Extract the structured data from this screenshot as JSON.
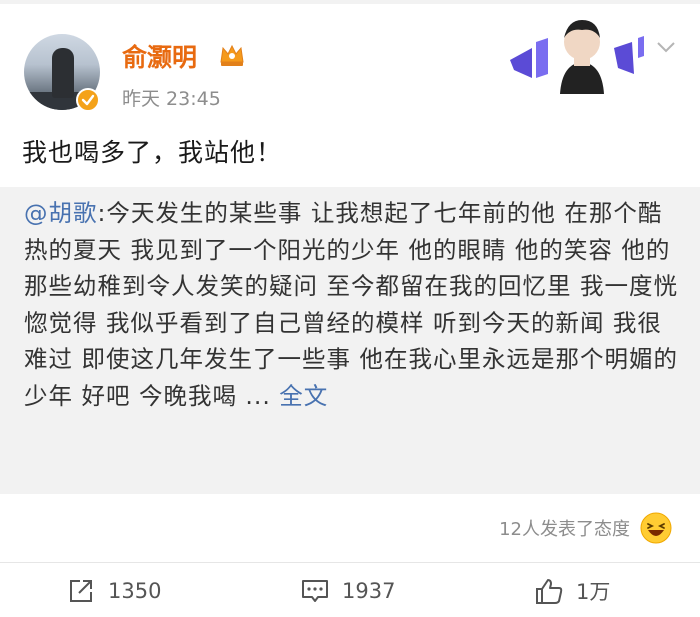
{
  "user": {
    "name": "俞灏明",
    "time": "昨天 23:45"
  },
  "post": {
    "text": "我也喝多了，我站他！"
  },
  "repost": {
    "mention": "@胡歌",
    "text": ":今天发生的某些事 让我想起了七年前的他 在那个酷热的夏天 我见到了一个阳光的少年 他的眼睛 他的笑容 他的那些幼稚到令人发笑的疑问 至今都留在我的回忆里 我一度恍惚觉得 我似乎看到了自己曾经的模样 听到今天的新闻 我很难过 即使这几年发生了一些事 他在我心里永远是那个明媚的少年 好吧 今晚我喝 ... ",
    "full_link": "全文"
  },
  "reactions": {
    "text": "12人发表了态度"
  },
  "actions": {
    "repost_count": "1350",
    "comment_count": "1937",
    "like_count": "1万"
  },
  "icons": {
    "verified": "verified-badge-icon",
    "crown": "vip-crown-icon",
    "card": "profile-card-decoration",
    "chevron": "chevron-down-icon",
    "emoji": "laughing-emoji-icon",
    "repost": "repost-icon",
    "comment": "comment-icon",
    "like": "thumbs-up-icon"
  },
  "colors": {
    "username": "#e86a10",
    "link": "#4872b0",
    "verified": "#f4a21a",
    "repost_bg": "#f2f2f2"
  }
}
